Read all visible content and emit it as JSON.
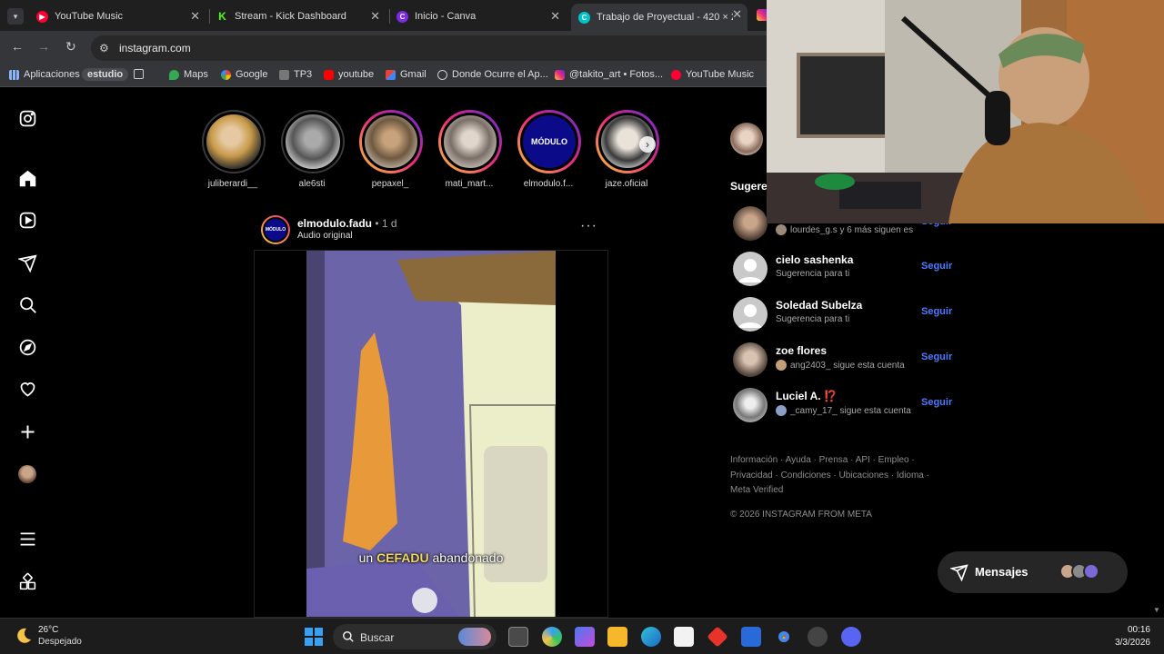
{
  "tabs": [
    {
      "title": "YouTube Music",
      "color": "#ff0033"
    },
    {
      "title": "Stream - Kick Dashboard",
      "color": "#53fc18"
    },
    {
      "title": "Inicio - Canva",
      "color": "#7d2ae8"
    },
    {
      "title": "Trabajo de Proyectual - 420 × 2",
      "color": "#00c4cc"
    }
  ],
  "address_bar": {
    "url": "instagram.com"
  },
  "bookmarks": [
    {
      "label": "Aplicaciones"
    },
    {
      "label": "estudio"
    },
    {
      "label": "Maps"
    },
    {
      "label": "Google"
    },
    {
      "label": "TP3"
    },
    {
      "label": "youtube"
    },
    {
      "label": "Gmail"
    },
    {
      "label": "Donde Ocurre el Ap..."
    },
    {
      "label": "@takito_art • Fotos..."
    },
    {
      "label": "YouTube Music"
    }
  ],
  "left_nav": [
    "instagram-logo-icon",
    "home-icon",
    "reels-icon",
    "send-icon",
    "search-icon",
    "explore-icon",
    "heart-icon",
    "create-icon",
    "profile-avatar",
    "menu-icon",
    "apps-icon"
  ],
  "stories": [
    {
      "username": "juliberardi__",
      "seen": true
    },
    {
      "username": "ale6sti",
      "seen": true
    },
    {
      "username": "pepaxel_",
      "seen": false
    },
    {
      "username": "mati_mart...",
      "seen": false
    },
    {
      "username": "elmodulo.f...",
      "seen": false
    },
    {
      "username": "jaze.oficial",
      "seen": false
    }
  ],
  "post": {
    "username": "elmodulo.fadu",
    "time": "• 1 d",
    "audio": "Audio original",
    "avatar_text": "MÓDULO",
    "caption_prefix": "un ",
    "caption_highlight": "CEFADU",
    "caption_suffix": " abandonado"
  },
  "sidebar": {
    "suggestions_title": "Sugeren",
    "partial_row": {
      "subtitle": "lourdes_g.s y 6 más siguen es",
      "follow": "Seguir"
    },
    "suggestions": [
      {
        "name": "cielo sashenka",
        "subtitle": "Sugerencia para ti",
        "follow": "Seguir"
      },
      {
        "name": "Soledad Subelza",
        "subtitle": "Sugerencia para ti",
        "follow": "Seguir"
      },
      {
        "name": "zoe flores",
        "subtitle": "ang2403_ sigue esta cuenta",
        "follow": "Seguir"
      },
      {
        "name": "Luciel A. ⁉️",
        "subtitle": "_camy_17_ sigue esta cuenta",
        "follow": "Seguir"
      }
    ],
    "footer_links": "Información · Ayuda · Prensa · API · Empleo · Privacidad · Condiciones · Ubicaciones · Idioma · Meta Verified",
    "copyright": "© 2026 INSTAGRAM FROM META"
  },
  "messages": {
    "label": "Mensajes"
  },
  "taskbar": {
    "temperature": "26°C",
    "condition": "Despejado",
    "search_placeholder": "Buscar",
    "time": "00:16",
    "date": "3/3/2026"
  }
}
